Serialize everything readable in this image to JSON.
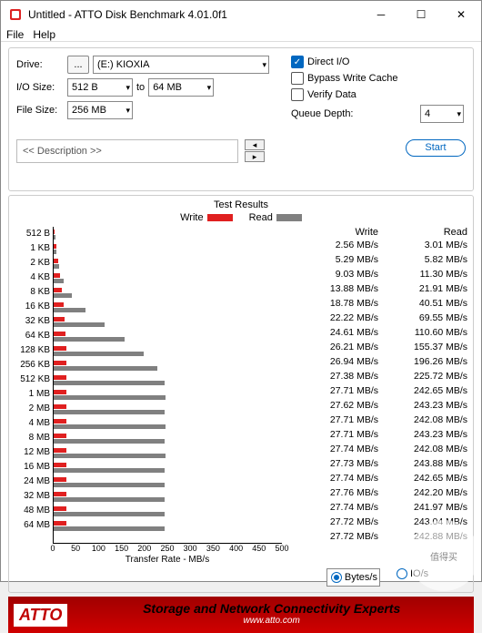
{
  "window": {
    "title": "Untitled - ATTO Disk Benchmark 4.01.0f1"
  },
  "menu": {
    "file": "File",
    "help": "Help"
  },
  "form": {
    "drive_label": "Drive:",
    "drive_btn": "...",
    "drive_value": "(E:) KIOXIA",
    "io_label": "I/O Size:",
    "io_from": "512 B",
    "io_to_lbl": "to",
    "io_to": "64 MB",
    "fs_label": "File Size:",
    "fs_value": "256 MB",
    "direct_io": "Direct I/O",
    "bypass": "Bypass Write Cache",
    "verify": "Verify Data",
    "qd_label": "Queue Depth:",
    "qd_value": "4",
    "desc": "<< Description >>",
    "start": "Start"
  },
  "results": {
    "title": "Test Results",
    "legend_write": "Write",
    "legend_read": "Read",
    "hdr_write": "Write",
    "hdr_read": "Read",
    "xlabel": "Transfer Rate - MB/s",
    "unit_bytes": "Bytes/s",
    "unit_io": "IO/s"
  },
  "chart_data": {
    "type": "bar",
    "xlabel": "Transfer Rate - MB/s",
    "ylabel": "I/O Size",
    "xlim": [
      0,
      500
    ],
    "xticks": [
      0,
      50,
      100,
      150,
      200,
      250,
      300,
      350,
      400,
      450,
      500
    ],
    "series": [
      {
        "name": "Write",
        "color": "#e02020"
      },
      {
        "name": "Read",
        "color": "#808080"
      }
    ],
    "rows": [
      {
        "label": "512 B",
        "write": 2.56,
        "read": 3.01
      },
      {
        "label": "1 KB",
        "write": 5.29,
        "read": 5.82
      },
      {
        "label": "2 KB",
        "write": 9.03,
        "read": 11.3
      },
      {
        "label": "4 KB",
        "write": 13.88,
        "read": 21.91
      },
      {
        "label": "8 KB",
        "write": 18.78,
        "read": 40.51
      },
      {
        "label": "16 KB",
        "write": 22.22,
        "read": 69.55
      },
      {
        "label": "32 KB",
        "write": 24.61,
        "read": 110.6
      },
      {
        "label": "64 KB",
        "write": 26.21,
        "read": 155.37
      },
      {
        "label": "128 KB",
        "write": 26.94,
        "read": 196.26
      },
      {
        "label": "256 KB",
        "write": 27.38,
        "read": 225.72
      },
      {
        "label": "512 KB",
        "write": 27.71,
        "read": 242.65
      },
      {
        "label": "1 MB",
        "write": 27.62,
        "read": 243.23
      },
      {
        "label": "2 MB",
        "write": 27.71,
        "read": 242.08
      },
      {
        "label": "4 MB",
        "write": 27.71,
        "read": 243.23
      },
      {
        "label": "8 MB",
        "write": 27.74,
        "read": 242.08
      },
      {
        "label": "12 MB",
        "write": 27.73,
        "read": 243.88
      },
      {
        "label": "16 MB",
        "write": 27.74,
        "read": 242.65
      },
      {
        "label": "24 MB",
        "write": 27.76,
        "read": 242.2
      },
      {
        "label": "32 MB",
        "write": 27.74,
        "read": 241.97
      },
      {
        "label": "48 MB",
        "write": 27.72,
        "read": 243.04
      },
      {
        "label": "64 MB",
        "write": 27.72,
        "read": 242.88
      }
    ]
  },
  "footer": {
    "brand": "ATTO",
    "slogan": "Storage and Network Connectivity Experts",
    "url": "www.atto.com"
  },
  "watermark": "值得买"
}
